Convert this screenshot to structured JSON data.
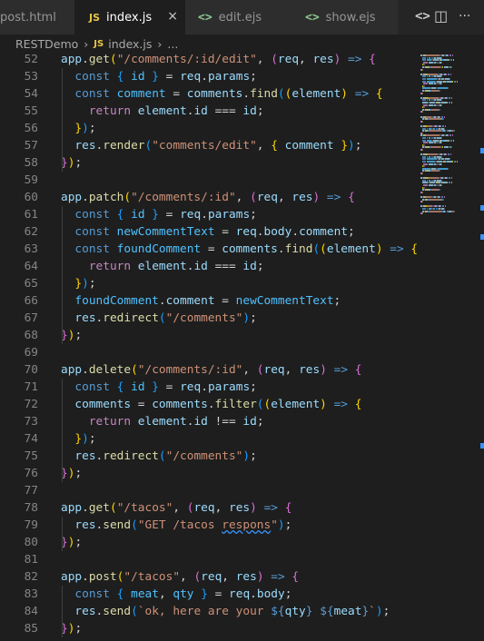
{
  "tabs": [
    {
      "label": "post.html",
      "icon": "html-icon",
      "active": false
    },
    {
      "label": "index.js",
      "icon": "js-icon",
      "active": true
    },
    {
      "label": "edit.ejs",
      "icon": "ejs-icon",
      "active": false
    },
    {
      "label": "show.ejs",
      "icon": "ejs-icon",
      "active": false
    }
  ],
  "tab_icons": {
    "js": "JS",
    "ejs": "<>",
    "close": "×",
    "ejs_action": "<>",
    "split": "◫",
    "more": "···"
  },
  "breadcrumb": {
    "folder": "RESTDemo",
    "file": "index.js",
    "more": "..."
  },
  "code_lines": [
    {
      "n": "52",
      "tokens": [
        [
          "id",
          "app"
        ],
        [
          "p",
          "."
        ],
        [
          "fn",
          "get"
        ],
        [
          "b1",
          "("
        ],
        [
          "str",
          "\"/comments/:id/edit\""
        ],
        [
          "p",
          ", "
        ],
        [
          "b2",
          "("
        ],
        [
          "id",
          "req"
        ],
        [
          "p",
          ", "
        ],
        [
          "id",
          "res"
        ],
        [
          "b2",
          ")"
        ],
        [
          "p",
          " "
        ],
        [
          "kw",
          "=>"
        ],
        [
          "p",
          " "
        ],
        [
          "b2",
          "{"
        ]
      ]
    },
    {
      "n": "53",
      "tokens": [
        [
          "p",
          "  "
        ],
        [
          "kw",
          "const"
        ],
        [
          "p",
          " "
        ],
        [
          "b3",
          "{"
        ],
        [
          "p",
          " "
        ],
        [
          "var",
          "id"
        ],
        [
          "p",
          " "
        ],
        [
          "b3",
          "}"
        ],
        [
          "p",
          " = "
        ],
        [
          "id",
          "req"
        ],
        [
          "p",
          "."
        ],
        [
          "id",
          "params"
        ],
        [
          "p",
          ";"
        ]
      ]
    },
    {
      "n": "54",
      "tokens": [
        [
          "p",
          "  "
        ],
        [
          "kw",
          "const"
        ],
        [
          "p",
          " "
        ],
        [
          "var",
          "comment"
        ],
        [
          "p",
          " = "
        ],
        [
          "id",
          "comments"
        ],
        [
          "p",
          "."
        ],
        [
          "fn",
          "find"
        ],
        [
          "b3",
          "("
        ],
        [
          "b1",
          "("
        ],
        [
          "id",
          "element"
        ],
        [
          "b1",
          ")"
        ],
        [
          "p",
          " "
        ],
        [
          "kw",
          "=>"
        ],
        [
          "p",
          " "
        ],
        [
          "b1",
          "{"
        ]
      ]
    },
    {
      "n": "55",
      "tokens": [
        [
          "p",
          "    "
        ],
        [
          "kwc",
          "return"
        ],
        [
          "p",
          " "
        ],
        [
          "id",
          "element"
        ],
        [
          "p",
          "."
        ],
        [
          "id",
          "id"
        ],
        [
          "p",
          " === "
        ],
        [
          "id",
          "id"
        ],
        [
          "p",
          ";"
        ]
      ]
    },
    {
      "n": "56",
      "tokens": [
        [
          "p",
          "  "
        ],
        [
          "b1",
          "}"
        ],
        [
          "b3",
          ")"
        ],
        [
          "p",
          ";"
        ]
      ]
    },
    {
      "n": "57",
      "tokens": [
        [
          "p",
          "  "
        ],
        [
          "id",
          "res"
        ],
        [
          "p",
          "."
        ],
        [
          "fn",
          "render"
        ],
        [
          "b3",
          "("
        ],
        [
          "str",
          "\"comments/edit\""
        ],
        [
          "p",
          ", "
        ],
        [
          "b1",
          "{"
        ],
        [
          "p",
          " "
        ],
        [
          "id",
          "comment"
        ],
        [
          "p",
          " "
        ],
        [
          "b1",
          "}"
        ],
        [
          "b3",
          ")"
        ],
        [
          "p",
          ";"
        ]
      ]
    },
    {
      "n": "58",
      "tokens": [
        [
          "b2",
          "}"
        ],
        [
          "b1",
          ")"
        ],
        [
          "p",
          ";"
        ]
      ]
    },
    {
      "n": "59",
      "tokens": []
    },
    {
      "n": "60",
      "tokens": [
        [
          "id",
          "app"
        ],
        [
          "p",
          "."
        ],
        [
          "fn",
          "patch"
        ],
        [
          "b1",
          "("
        ],
        [
          "str",
          "\"/comments/:id\""
        ],
        [
          "p",
          ", "
        ],
        [
          "b2",
          "("
        ],
        [
          "id",
          "req"
        ],
        [
          "p",
          ", "
        ],
        [
          "id",
          "res"
        ],
        [
          "b2",
          ")"
        ],
        [
          "p",
          " "
        ],
        [
          "kw",
          "=>"
        ],
        [
          "p",
          " "
        ],
        [
          "b2",
          "{"
        ]
      ]
    },
    {
      "n": "61",
      "tokens": [
        [
          "p",
          "  "
        ],
        [
          "kw",
          "const"
        ],
        [
          "p",
          " "
        ],
        [
          "b3",
          "{"
        ],
        [
          "p",
          " "
        ],
        [
          "var",
          "id"
        ],
        [
          "p",
          " "
        ],
        [
          "b3",
          "}"
        ],
        [
          "p",
          " = "
        ],
        [
          "id",
          "req"
        ],
        [
          "p",
          "."
        ],
        [
          "id",
          "params"
        ],
        [
          "p",
          ";"
        ]
      ]
    },
    {
      "n": "62",
      "tokens": [
        [
          "p",
          "  "
        ],
        [
          "kw",
          "const"
        ],
        [
          "p",
          " "
        ],
        [
          "var",
          "newCommentText"
        ],
        [
          "p",
          " = "
        ],
        [
          "id",
          "req"
        ],
        [
          "p",
          "."
        ],
        [
          "id",
          "body"
        ],
        [
          "p",
          "."
        ],
        [
          "id",
          "comment"
        ],
        [
          "p",
          ";"
        ]
      ]
    },
    {
      "n": "63",
      "tokens": [
        [
          "p",
          "  "
        ],
        [
          "kw",
          "const"
        ],
        [
          "p",
          " "
        ],
        [
          "var",
          "foundComment"
        ],
        [
          "p",
          " = "
        ],
        [
          "id",
          "comments"
        ],
        [
          "p",
          "."
        ],
        [
          "fn",
          "find"
        ],
        [
          "b3",
          "("
        ],
        [
          "b1",
          "("
        ],
        [
          "id",
          "element"
        ],
        [
          "b1",
          ")"
        ],
        [
          "p",
          " "
        ],
        [
          "kw",
          "=>"
        ],
        [
          "p",
          " "
        ],
        [
          "b1",
          "{"
        ]
      ]
    },
    {
      "n": "64",
      "tokens": [
        [
          "p",
          "    "
        ],
        [
          "kwc",
          "return"
        ],
        [
          "p",
          " "
        ],
        [
          "id",
          "element"
        ],
        [
          "p",
          "."
        ],
        [
          "id",
          "id"
        ],
        [
          "p",
          " === "
        ],
        [
          "id",
          "id"
        ],
        [
          "p",
          ";"
        ]
      ]
    },
    {
      "n": "65",
      "tokens": [
        [
          "p",
          "  "
        ],
        [
          "b1",
          "}"
        ],
        [
          "b3",
          ")"
        ],
        [
          "p",
          ";"
        ]
      ]
    },
    {
      "n": "66",
      "tokens": [
        [
          "p",
          "  "
        ],
        [
          "var",
          "foundComment"
        ],
        [
          "p",
          "."
        ],
        [
          "id",
          "comment"
        ],
        [
          "p",
          " = "
        ],
        [
          "var",
          "newCommentText"
        ],
        [
          "p",
          ";"
        ]
      ]
    },
    {
      "n": "67",
      "tokens": [
        [
          "p",
          "  "
        ],
        [
          "id",
          "res"
        ],
        [
          "p",
          "."
        ],
        [
          "fn",
          "redirect"
        ],
        [
          "b3",
          "("
        ],
        [
          "str",
          "\"/comments\""
        ],
        [
          "b3",
          ")"
        ],
        [
          "p",
          ";"
        ]
      ]
    },
    {
      "n": "68",
      "tokens": [
        [
          "b2",
          "}"
        ],
        [
          "b1",
          ")"
        ],
        [
          "p",
          ";"
        ]
      ]
    },
    {
      "n": "69",
      "tokens": []
    },
    {
      "n": "70",
      "tokens": [
        [
          "id",
          "app"
        ],
        [
          "p",
          "."
        ],
        [
          "fn",
          "delete"
        ],
        [
          "b1",
          "("
        ],
        [
          "str",
          "\"/comments/:id\""
        ],
        [
          "p",
          ", "
        ],
        [
          "b2",
          "("
        ],
        [
          "id",
          "req"
        ],
        [
          "p",
          ", "
        ],
        [
          "id",
          "res"
        ],
        [
          "b2",
          ")"
        ],
        [
          "p",
          " "
        ],
        [
          "kw",
          "=>"
        ],
        [
          "p",
          " "
        ],
        [
          "b2",
          "{"
        ]
      ]
    },
    {
      "n": "71",
      "tokens": [
        [
          "p",
          "  "
        ],
        [
          "kw",
          "const"
        ],
        [
          "p",
          " "
        ],
        [
          "b3",
          "{"
        ],
        [
          "p",
          " "
        ],
        [
          "var",
          "id"
        ],
        [
          "p",
          " "
        ],
        [
          "b3",
          "}"
        ],
        [
          "p",
          " = "
        ],
        [
          "id",
          "req"
        ],
        [
          "p",
          "."
        ],
        [
          "id",
          "params"
        ],
        [
          "p",
          ";"
        ]
      ]
    },
    {
      "n": "72",
      "tokens": [
        [
          "p",
          "  "
        ],
        [
          "id",
          "comments"
        ],
        [
          "p",
          " = "
        ],
        [
          "id",
          "comments"
        ],
        [
          "p",
          "."
        ],
        [
          "fn",
          "filter"
        ],
        [
          "b3",
          "("
        ],
        [
          "b1",
          "("
        ],
        [
          "id",
          "element"
        ],
        [
          "b1",
          ")"
        ],
        [
          "p",
          " "
        ],
        [
          "kw",
          "=>"
        ],
        [
          "p",
          " "
        ],
        [
          "b1",
          "{"
        ]
      ]
    },
    {
      "n": "73",
      "tokens": [
        [
          "p",
          "    "
        ],
        [
          "kwc",
          "return"
        ],
        [
          "p",
          " "
        ],
        [
          "id",
          "element"
        ],
        [
          "p",
          "."
        ],
        [
          "id",
          "id"
        ],
        [
          "p",
          " !== "
        ],
        [
          "id",
          "id"
        ],
        [
          "p",
          ";"
        ]
      ]
    },
    {
      "n": "74",
      "tokens": [
        [
          "p",
          "  "
        ],
        [
          "b1",
          "}"
        ],
        [
          "b3",
          ")"
        ],
        [
          "p",
          ";"
        ]
      ]
    },
    {
      "n": "75",
      "tokens": [
        [
          "p",
          "  "
        ],
        [
          "id",
          "res"
        ],
        [
          "p",
          "."
        ],
        [
          "fn",
          "redirect"
        ],
        [
          "b3",
          "("
        ],
        [
          "str",
          "\"/comments\""
        ],
        [
          "b3",
          ")"
        ],
        [
          "p",
          ";"
        ]
      ]
    },
    {
      "n": "76",
      "tokens": [
        [
          "b2",
          "}"
        ],
        [
          "b1",
          ")"
        ],
        [
          "p",
          ";"
        ]
      ]
    },
    {
      "n": "77",
      "tokens": []
    },
    {
      "n": "78",
      "tokens": [
        [
          "id",
          "app"
        ],
        [
          "p",
          "."
        ],
        [
          "fn",
          "get"
        ],
        [
          "b1",
          "("
        ],
        [
          "str",
          "\"/tacos\""
        ],
        [
          "p",
          ", "
        ],
        [
          "b2",
          "("
        ],
        [
          "id",
          "req"
        ],
        [
          "p",
          ", "
        ],
        [
          "id",
          "res"
        ],
        [
          "b2",
          ")"
        ],
        [
          "p",
          " "
        ],
        [
          "kw",
          "=>"
        ],
        [
          "p",
          " "
        ],
        [
          "b2",
          "{"
        ]
      ]
    },
    {
      "n": "79",
      "tokens": [
        [
          "p",
          "  "
        ],
        [
          "id",
          "res"
        ],
        [
          "p",
          "."
        ],
        [
          "fn",
          "send"
        ],
        [
          "b3",
          "("
        ],
        [
          "str",
          "\"GET /tacos "
        ],
        [
          "strsq",
          "respons"
        ],
        [
          "str",
          "\""
        ],
        [
          "b3",
          ")"
        ],
        [
          "p",
          ";"
        ]
      ]
    },
    {
      "n": "80",
      "tokens": [
        [
          "b2",
          "}"
        ],
        [
          "b1",
          ")"
        ],
        [
          "p",
          ";"
        ]
      ]
    },
    {
      "n": "81",
      "tokens": []
    },
    {
      "n": "82",
      "tokens": [
        [
          "id",
          "app"
        ],
        [
          "p",
          "."
        ],
        [
          "fn",
          "post"
        ],
        [
          "b1",
          "("
        ],
        [
          "str",
          "\"/tacos\""
        ],
        [
          "p",
          ", "
        ],
        [
          "b2",
          "("
        ],
        [
          "id",
          "req"
        ],
        [
          "p",
          ", "
        ],
        [
          "id",
          "res"
        ],
        [
          "b2",
          ")"
        ],
        [
          "p",
          " "
        ],
        [
          "kw",
          "=>"
        ],
        [
          "p",
          " "
        ],
        [
          "b2",
          "{"
        ]
      ]
    },
    {
      "n": "83",
      "tokens": [
        [
          "p",
          "  "
        ],
        [
          "kw",
          "const"
        ],
        [
          "p",
          " "
        ],
        [
          "b3",
          "{"
        ],
        [
          "p",
          " "
        ],
        [
          "var",
          "meat"
        ],
        [
          "p",
          ", "
        ],
        [
          "var",
          "qty"
        ],
        [
          "p",
          " "
        ],
        [
          "b3",
          "}"
        ],
        [
          "p",
          " = "
        ],
        [
          "id",
          "req"
        ],
        [
          "p",
          "."
        ],
        [
          "id",
          "body"
        ],
        [
          "p",
          ";"
        ]
      ]
    },
    {
      "n": "84",
      "tokens": [
        [
          "p",
          "  "
        ],
        [
          "id",
          "res"
        ],
        [
          "p",
          "."
        ],
        [
          "fn",
          "send"
        ],
        [
          "b3",
          "("
        ],
        [
          "str",
          "`ok, here are your "
        ],
        [
          "kw",
          "${"
        ],
        [
          "id",
          "qty"
        ],
        [
          "kw",
          "}"
        ],
        [
          "str",
          " "
        ],
        [
          "kw",
          "${"
        ],
        [
          "id",
          "meat"
        ],
        [
          "kw",
          "}"
        ],
        [
          "str",
          "`"
        ],
        [
          "b3",
          ")"
        ],
        [
          "p",
          ";"
        ]
      ]
    },
    {
      "n": "85",
      "tokens": [
        [
          "b2",
          "}"
        ],
        [
          "b1",
          ")"
        ],
        [
          "p",
          ";"
        ]
      ]
    }
  ],
  "colors": {
    "editor_bg": "#1e1e1e",
    "tabbar_bg": "#252526",
    "line_number": "#858585",
    "identifier": "#9cdcfe",
    "function": "#dcdcaa",
    "keyword": "#569cd6",
    "control_keyword": "#c586c0",
    "string": "#ce9178",
    "constant": "#4fc1ff",
    "bracket_1": "#ffd700",
    "bracket_2": "#da70d6",
    "bracket_3": "#179fff",
    "accent": "#3794ff"
  }
}
